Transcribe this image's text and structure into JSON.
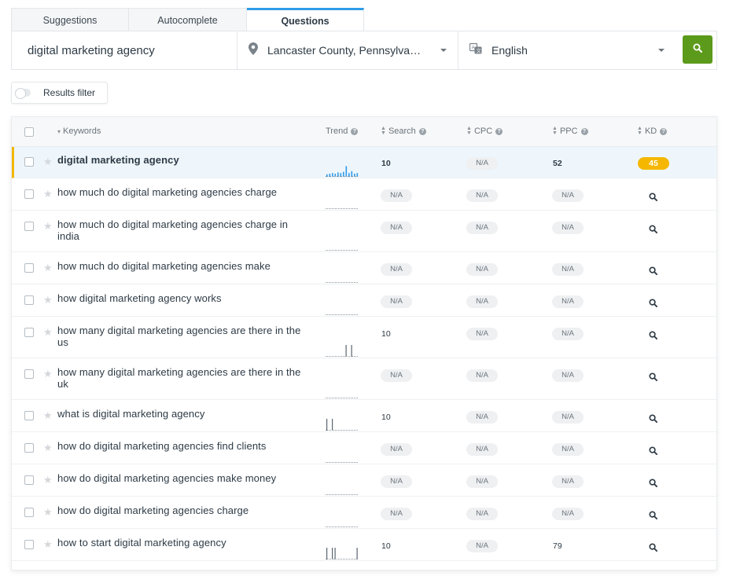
{
  "tabs": [
    {
      "label": "Suggestions"
    },
    {
      "label": "Autocomplete"
    },
    {
      "label": "Questions"
    }
  ],
  "search": {
    "keyword_value": "digital marketing agency",
    "location": "Lancaster County, Pennsylva…",
    "language": "English",
    "icons": {
      "location": "map-pin-icon",
      "language": "translate-icon",
      "go": "search-icon"
    }
  },
  "filter": {
    "label": "Results filter"
  },
  "colors": {
    "accent": "#2f9ce9",
    "go_button": "#5c9a1b",
    "kd_badge": "#f5b700",
    "highlight_bar": "#f3b800"
  },
  "table": {
    "headers": {
      "keywords": "Keywords",
      "trend": "Trend",
      "search": "Search",
      "cpc": "CPC",
      "ppc": "PPC",
      "kd": "KD"
    },
    "rows": [
      {
        "keyword": "digital marketing agency",
        "search": "10",
        "cpc": "N/A",
        "ppc": "52",
        "kd": "45",
        "trend": [
          0.2,
          0.25,
          0.3,
          0.25,
          0.35,
          0.3,
          0.4,
          0.85,
          0.3,
          0.45,
          0.25,
          0.3
        ]
      },
      {
        "keyword": "how much do digital marketing agencies charge",
        "search": "N/A",
        "cpc": "N/A",
        "ppc": "N/A",
        "kd": "",
        "trend": [
          0,
          0,
          0,
          0,
          0,
          0,
          0,
          0,
          0,
          0,
          0,
          0
        ]
      },
      {
        "keyword": "how much do digital marketing agencies charge in india",
        "search": "N/A",
        "cpc": "N/A",
        "ppc": "N/A",
        "kd": "",
        "trend": [
          0,
          0,
          0,
          0,
          0,
          0,
          0,
          0,
          0,
          0,
          0,
          0
        ]
      },
      {
        "keyword": "how much do digital marketing agencies make",
        "search": "N/A",
        "cpc": "N/A",
        "ppc": "N/A",
        "kd": "",
        "trend": [
          0,
          0,
          0,
          0,
          0,
          0,
          0,
          0,
          0,
          0,
          0,
          0
        ]
      },
      {
        "keyword": "how digital marketing agency works",
        "search": "N/A",
        "cpc": "N/A",
        "ppc": "N/A",
        "kd": "",
        "trend": [
          0,
          0,
          0,
          0,
          0,
          0,
          0,
          0,
          0,
          0,
          0,
          0
        ]
      },
      {
        "keyword": "how many digital marketing agencies are there in the us",
        "search": "10",
        "cpc": "N/A",
        "ppc": "N/A",
        "kd": "",
        "trend": [
          0,
          0,
          0,
          0,
          0,
          0,
          0,
          1,
          0,
          1,
          0,
          0
        ]
      },
      {
        "keyword": "how many digital marketing agencies are there in the uk",
        "search": "N/A",
        "cpc": "N/A",
        "ppc": "N/A",
        "kd": "",
        "trend": [
          0,
          0,
          0,
          0,
          0,
          0,
          0,
          0,
          0,
          0,
          0,
          0
        ]
      },
      {
        "keyword": "what is digital marketing agency",
        "search": "10",
        "cpc": "N/A",
        "ppc": "N/A",
        "kd": "",
        "trend": [
          1,
          0,
          1,
          0,
          0,
          0,
          0,
          0,
          0,
          0,
          0,
          0
        ]
      },
      {
        "keyword": "how do digital marketing agencies find clients",
        "search": "N/A",
        "cpc": "N/A",
        "ppc": "N/A",
        "kd": "",
        "trend": [
          0,
          0,
          0,
          0,
          0,
          0,
          0,
          0,
          0,
          0,
          0,
          0
        ]
      },
      {
        "keyword": "how do digital marketing agencies make money",
        "search": "N/A",
        "cpc": "N/A",
        "ppc": "N/A",
        "kd": "",
        "trend": [
          0,
          0,
          0,
          0,
          0,
          0,
          0,
          0,
          0,
          0,
          0,
          0
        ]
      },
      {
        "keyword": "how do digital marketing agencies charge",
        "search": "N/A",
        "cpc": "N/A",
        "ppc": "N/A",
        "kd": "",
        "trend": [
          0,
          0,
          0,
          0,
          0,
          0,
          0,
          0,
          0,
          0,
          0,
          0
        ]
      },
      {
        "keyword": "how to start digital marketing agency",
        "search": "10",
        "cpc": "N/A",
        "ppc": "79",
        "kd": "",
        "trend": [
          1,
          0,
          1,
          1,
          0,
          0,
          0,
          0,
          0,
          0,
          0,
          1
        ]
      }
    ]
  }
}
